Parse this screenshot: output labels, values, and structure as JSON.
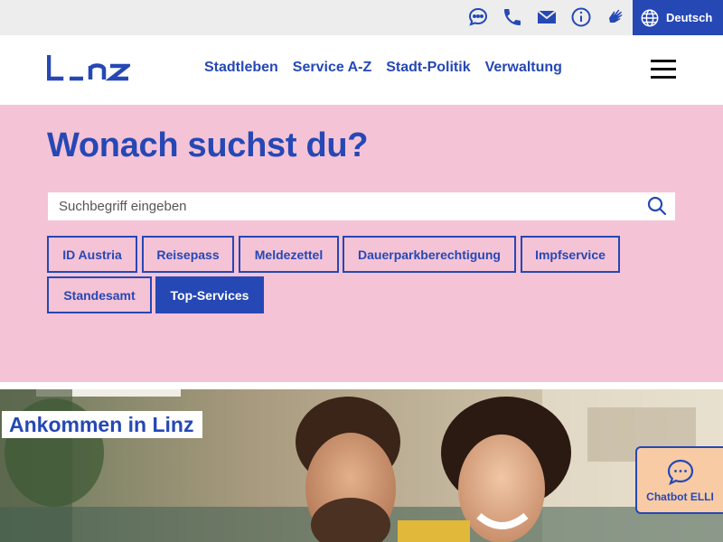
{
  "utilbar": {
    "icons": [
      "chat-icon",
      "phone-icon",
      "mail-icon",
      "info-icon",
      "sign-language-icon"
    ],
    "language_label": "Deutsch",
    "language_icon": "globe-icon"
  },
  "header": {
    "logo_text": "L_nz",
    "nav": [
      "Stadtleben",
      "Service A-Z",
      "Stadt-Politik",
      "Verwaltung"
    ],
    "menu_icon": "hamburger-menu-icon"
  },
  "search": {
    "heading": "Wonach suchst du?",
    "placeholder": "Suchbegriff eingeben",
    "value": "",
    "chips": [
      "ID Austria",
      "Reisepass",
      "Meldezettel",
      "Dauerparkberechtigung",
      "Impfservice",
      "Standesamt",
      "Top-Services"
    ],
    "active_chip": "Top-Services"
  },
  "feature": {
    "title": "Ankommen in Linz"
  },
  "chatbot": {
    "label": "Chatbot ELLI"
  },
  "colors": {
    "brand_blue": "#2548b5",
    "hero_pink": "#f5c3d6",
    "utilbar_grey": "#ededed",
    "chatbot_peach": "#f8cba5"
  }
}
